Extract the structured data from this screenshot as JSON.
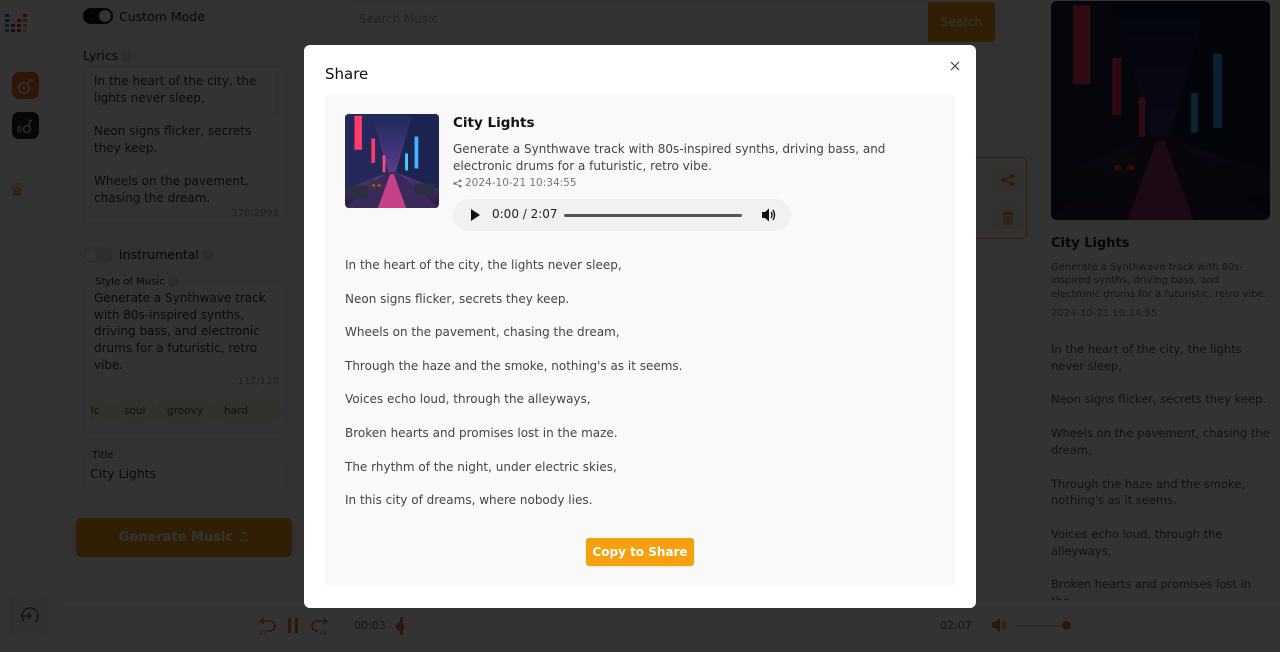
{
  "colors": {
    "accent": "#f29d1b",
    "accent_button": "#f5a00e",
    "accent_dark": "#f0701e",
    "overlay": "rgba(0,0,0,0.8)"
  },
  "sidebar": {
    "icons": [
      "logo-icon",
      "create-music-icon",
      "library-icon",
      "crown-icon",
      "logout-icon"
    ]
  },
  "form": {
    "custom_mode_label": "Custom Mode",
    "custom_mode_on": true,
    "lyrics_label": "Lyrics",
    "lyrics_value": "In the heart of the city, the lights never sleep,\n\nNeon signs flicker, secrets they keep.\n\nWheels on the pavement, chasing the dream.",
    "lyrics_counter": "370/2999",
    "instrumental_label": "Instrumental",
    "instrumental_on": false,
    "style_label": "Style of Music",
    "style_value": "Generate a Synthwave track with 80s-inspired synths, driving bass, and electronic drums for a futuristic, retro vibe.",
    "style_counter": "117/120",
    "style_chips": [
      "lic",
      "soul",
      "groovy",
      "hard rock"
    ],
    "title_label": "Title",
    "title_value": "City Lights",
    "generate_button": "Generate Music ♫"
  },
  "search": {
    "placeholder": "Search Music",
    "button": "Search"
  },
  "detail": {
    "title": "City Lights",
    "description": "Generate a Synthwave track with 80s-inspired synths, driving bass, and electronic drums for a futuristic, retro vibe.",
    "date": "2024-10-21 10:34:55",
    "lyrics": [
      "In the heart of the city, the lights never sleep,",
      "Neon signs flicker, secrets they keep.",
      "Wheels on the pavement, chasing the dream,",
      "Through the haze and the smoke, nothing's as it seems.",
      "Voices echo loud, through the alleyways,",
      "Broken hearts and promises lost in the"
    ]
  },
  "player": {
    "current_time": "00:03",
    "duration": "02:07",
    "progress_fraction": 0.024,
    "volume_fraction": 0.9,
    "rewind_label": "15",
    "forward_label": "15"
  },
  "modal": {
    "title": "Share",
    "song": {
      "title": "City Lights",
      "description": "Generate a Synthwave track with 80s-inspired synths, driving bass, and electronic drums for a futuristic, retro vibe.",
      "date": "2024-10-21 10:34:55",
      "audio_time": "0:00 / 2:07",
      "audio_progress_fraction": 0
    },
    "lyrics": [
      "In the heart of the city, the lights never sleep,",
      "Neon signs flicker, secrets they keep.",
      "Wheels on the pavement, chasing the dream,",
      "Through the haze and the smoke, nothing's as it seems.",
      "Voices echo loud, through the alleyways,",
      "Broken hearts and promises lost in the maze.",
      "The rhythm of the night, under electric skies,",
      "In this city of dreams, where nobody lies."
    ],
    "copy_button": "Copy to Share"
  }
}
